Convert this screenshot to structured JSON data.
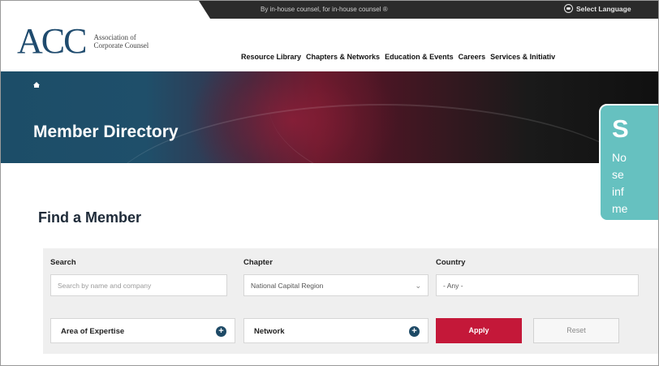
{
  "topbar": {
    "tagline": "By in-house counsel, for in-house counsel ®",
    "language_label": "Select Language",
    "language_icon": "globe-icon"
  },
  "header": {
    "logo_mark": "ACC",
    "logo_line1": "Association of",
    "logo_line2": "Corporate Counsel",
    "nav": [
      "Resource Library",
      "Chapters & Networks",
      "Education & Events",
      "Careers",
      "Services & Initiativ"
    ]
  },
  "hero": {
    "home_icon": "home-icon",
    "title": "Member Directory"
  },
  "find": {
    "title": "Find a Member",
    "search": {
      "label": "Search",
      "placeholder": "Search by name and company"
    },
    "chapter": {
      "label": "Chapter",
      "value": "National Capital Region"
    },
    "country": {
      "label": "Country",
      "value": "- Any -"
    },
    "expertise_label": "Area of Expertise",
    "network_label": "Network",
    "apply_label": "Apply",
    "reset_label": "Reset"
  },
  "callout": {
    "title": "S",
    "lines": [
      "No",
      "se",
      "inf",
      "me"
    ]
  },
  "colors": {
    "brand_blue": "#1f4b6e",
    "apply_red": "#c41839",
    "callout_teal": "#66c1c0"
  }
}
